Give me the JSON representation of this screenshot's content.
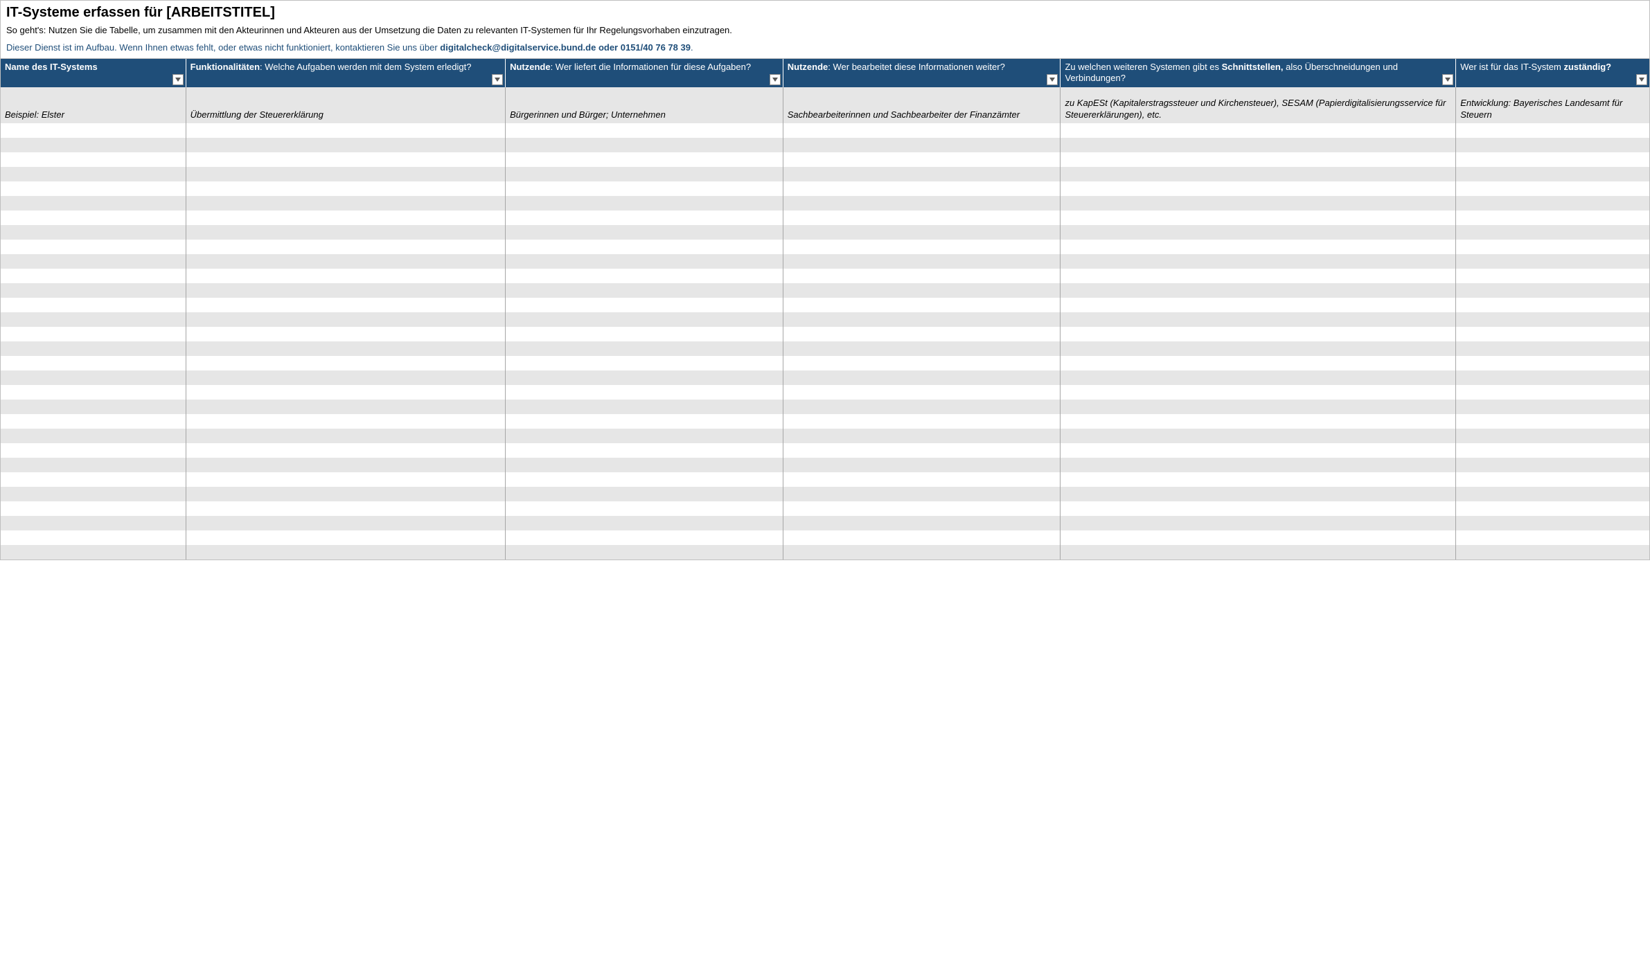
{
  "header": {
    "title": "IT-Systeme erfassen für [ARBEITSTITEL]",
    "instructions": "So geht's: Nutzen Sie die Tabelle, um zusammen mit den Akteurinnen und Akteuren aus der Umsetzung die Daten zu relevanten IT-Systemen für Ihr Regelungsvorhaben einzutragen.",
    "notice_pre": "Dieser Dienst ist im Aufbau. Wenn Ihnen etwas fehlt, oder etwas nicht funktioniert, kontaktieren Sie uns über ",
    "notice_bold": "digitalcheck@digitalservice.bund.de oder 0151/40 76 78 39",
    "notice_post": "."
  },
  "columns": {
    "c1_b": "Name des IT-Systems",
    "c2_b": "Funktionalitäten",
    "c2_t": ": Welche Aufgaben werden mit dem System erledigt?",
    "c3_b": "Nutzende",
    "c3_t": ": Wer liefert die Informationen für diese Aufgaben?",
    "c4_b": "Nutzende",
    "c4_t": ": Wer bearbeitet diese Informationen weiter?",
    "c5_p": "Zu welchen weiteren Systemen gibt es ",
    "c5_b": "Schnittstellen,",
    "c5_t": " also Überschneidungen und Verbindungen?",
    "c6_p": "Wer ist für das IT-System ",
    "c6_b": "zuständig?"
  },
  "example": {
    "c1": "Beispiel: Elster",
    "c2": "Übermittlung der Steuererklärung",
    "c3": "Bürgerinnen und Bürger; Unternehmen",
    "c4": "Sachbearbeiterinnen und Sachbearbeiter der Finanzämter",
    "c5": "zu KapESt (Kapitalerstragssteuer und Kirchensteuer), SESAM (Papierdigitalisierungsservice für Steuererklärungen), etc.",
    "c6": "Entwicklung: Bayerisches Landesamt für Steuern"
  },
  "emptyRowCount": 30
}
